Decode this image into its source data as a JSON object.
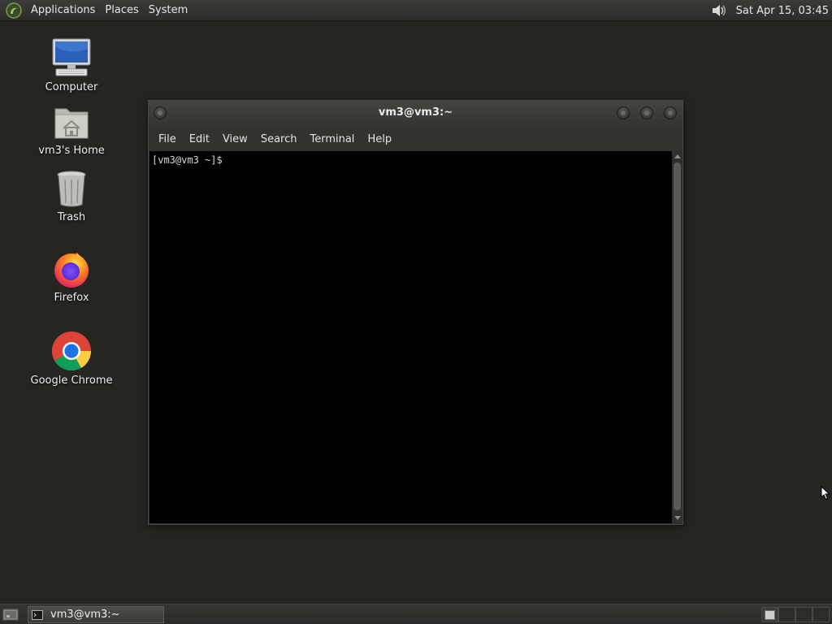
{
  "top_panel": {
    "menus": [
      "Applications",
      "Places",
      "System"
    ],
    "clock": "Sat Apr 15, 03:45",
    "icons": {
      "logo": "mate-logo-icon",
      "volume": "speaker-volume-icon"
    }
  },
  "desktop": {
    "icons": [
      {
        "label": "Computer",
        "icon": "computer-icon"
      },
      {
        "label": "vm3's Home",
        "icon": "home-folder-icon"
      },
      {
        "label": "Trash",
        "icon": "trash-icon"
      },
      {
        "label": "Firefox",
        "icon": "firefox-icon"
      },
      {
        "label": "Google Chrome",
        "icon": "chrome-icon"
      }
    ]
  },
  "terminal": {
    "title": "vm3@vm3:~",
    "menus": [
      "File",
      "Edit",
      "View",
      "Search",
      "Terminal",
      "Help"
    ],
    "prompt": "[vm3@vm3 ~]$ "
  },
  "taskbar": {
    "tasks": [
      {
        "label": "vm3@vm3:~",
        "icon": "terminal-icon"
      }
    ]
  },
  "colors": {
    "desktop_bg": "#252522",
    "panel_bg": "#2c2c2a",
    "terminal_bg": "#000000",
    "text": "#e8e8e8"
  }
}
